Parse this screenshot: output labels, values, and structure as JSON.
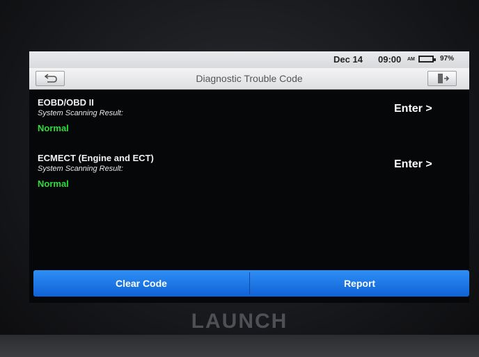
{
  "status": {
    "date": "Dec 14",
    "time": "09:00",
    "ampm": "AM",
    "battery": "97%"
  },
  "header": {
    "title": "Diagnostic Trouble Code"
  },
  "systems": [
    {
      "name": "EOBD/OBD II",
      "subtitle": "System Scanning Result:",
      "result": "Normal",
      "action": "Enter >"
    },
    {
      "name": "ECMECT (Engine and ECT)",
      "subtitle": "System Scanning Result:",
      "result": "Normal",
      "action": "Enter >"
    }
  ],
  "actions": {
    "clear_code": "Clear Code",
    "report": "Report"
  },
  "brand": "LAUNCH",
  "colors": {
    "accent": "#1a74e8",
    "result_normal": "#2fdc3c"
  },
  "icons": {
    "back": "back-arrow-icon",
    "exit": "exit-door-icon",
    "battery": "battery-icon"
  }
}
